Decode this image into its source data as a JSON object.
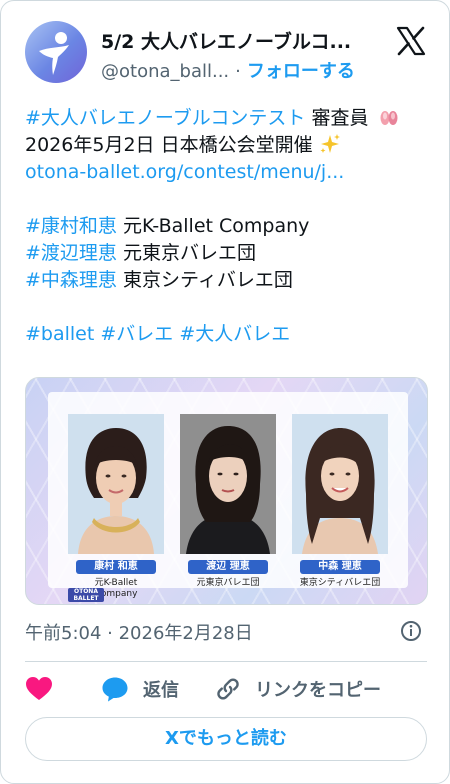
{
  "header": {
    "name": "5/2 大人バレエノーブルコ...",
    "handle": "@otona_ball...",
    "separator": "·",
    "follow_label": "フォローする"
  },
  "post": {
    "lines": [
      {
        "tag": "#大人バレエノーブルコンテスト",
        "text": " 審査員",
        "emoji": "ballet-shoes"
      },
      {
        "text": "2026年5月2日 日本橋公会堂開催",
        "emoji": "sparkles"
      },
      {
        "link": "otona-ballet.org/contest/menu/j..."
      },
      {
        "tag": "#康村和恵",
        "text": " 元K-Ballet Company"
      },
      {
        "tag": "#渡辺理恵",
        "text": " 元東京バレエ団"
      },
      {
        "tag": "#中森理恵",
        "text": " 東京シティバレエ団"
      },
      {
        "tags": "#ballet #バレエ #大人バレエ"
      }
    ]
  },
  "media": {
    "judges": [
      {
        "name": "康村 和恵",
        "caption1": "元K-Ballet",
        "caption2": "Company"
      },
      {
        "name": "渡辺 理恵",
        "caption1": "元東京バレエ団",
        "caption2": ""
      },
      {
        "name": "中森 理恵",
        "caption1": "東京シティバレエ団",
        "caption2": ""
      }
    ],
    "brand_line1": "OTONA",
    "brand_line2": "BALLET"
  },
  "meta": {
    "timestamp": "午前5:04 · 2026年2月28日"
  },
  "actions": {
    "like_icon": "heart-icon",
    "reply_label": "返信",
    "copy_label": "リンクをコピー"
  },
  "read_more_label": "Xでもっと読む",
  "colors": {
    "accent": "#1d9bf0",
    "like": "#f91880",
    "text": "#0f1419",
    "muted": "#536471"
  }
}
